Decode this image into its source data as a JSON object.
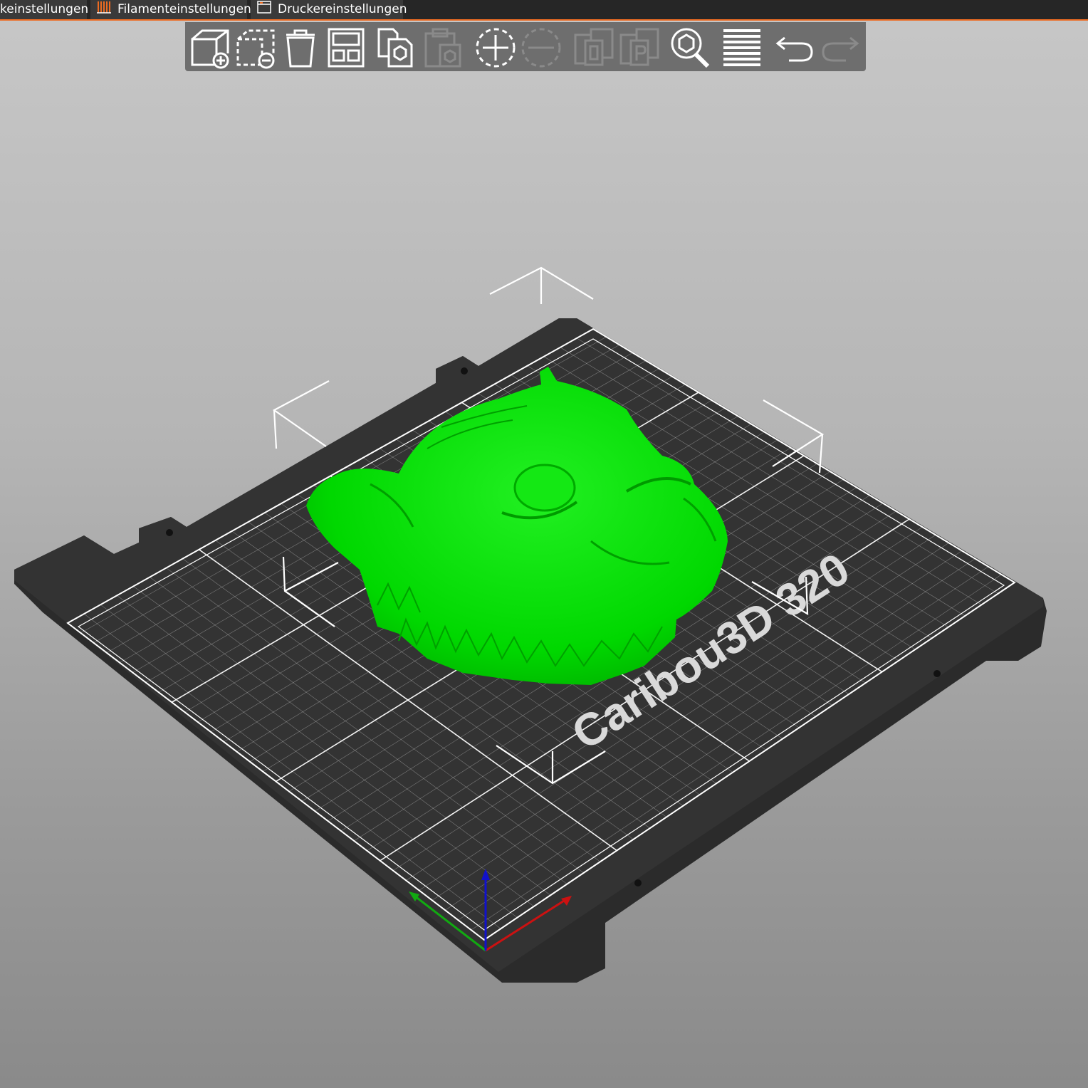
{
  "tabs": [
    {
      "label": "keinstellungen"
    },
    {
      "label": "Filamenteinstellungen",
      "icon": "filament-icon"
    },
    {
      "label": "Druckereinstellungen",
      "icon": "printer-settings-icon"
    }
  ],
  "toolbar": {
    "buttons": [
      {
        "name": "add-button",
        "icon": "add-object-icon",
        "enabled": true
      },
      {
        "name": "delete-button",
        "icon": "delete-object-icon",
        "enabled": true
      },
      {
        "name": "delete-all-button",
        "icon": "trash-icon",
        "enabled": true
      },
      {
        "name": "arrange-button",
        "icon": "arrange-icon",
        "enabled": true
      },
      {
        "name": "copy-button",
        "icon": "copy-icon",
        "enabled": true
      },
      {
        "name": "paste-button",
        "icon": "paste-icon",
        "enabled": false
      },
      {
        "name": "add-instance-button",
        "icon": "add-instance-icon",
        "enabled": true
      },
      {
        "name": "remove-instance-button",
        "icon": "remove-instance-icon",
        "enabled": false
      },
      {
        "name": "split-to-objects-button",
        "icon": "split-objects-icon",
        "enabled": false
      },
      {
        "name": "split-to-parts-button",
        "icon": "split-parts-icon",
        "enabled": false
      },
      {
        "name": "search-button",
        "icon": "search-icon",
        "enabled": true
      },
      {
        "name": "layers-button",
        "icon": "layers-icon",
        "enabled": true
      },
      {
        "name": "undo-button",
        "icon": "undo-icon",
        "enabled": true
      },
      {
        "name": "redo-button",
        "icon": "redo-icon",
        "enabled": false
      }
    ]
  },
  "bed": {
    "label": "Caribou3D 320",
    "model_color": "#00e000",
    "bed_color": "#2e2e2e"
  },
  "colors": {
    "accent": "#ed6b21",
    "x_axis": "#cc1111",
    "y_axis": "#11aa11",
    "z_axis": "#1111cc"
  }
}
